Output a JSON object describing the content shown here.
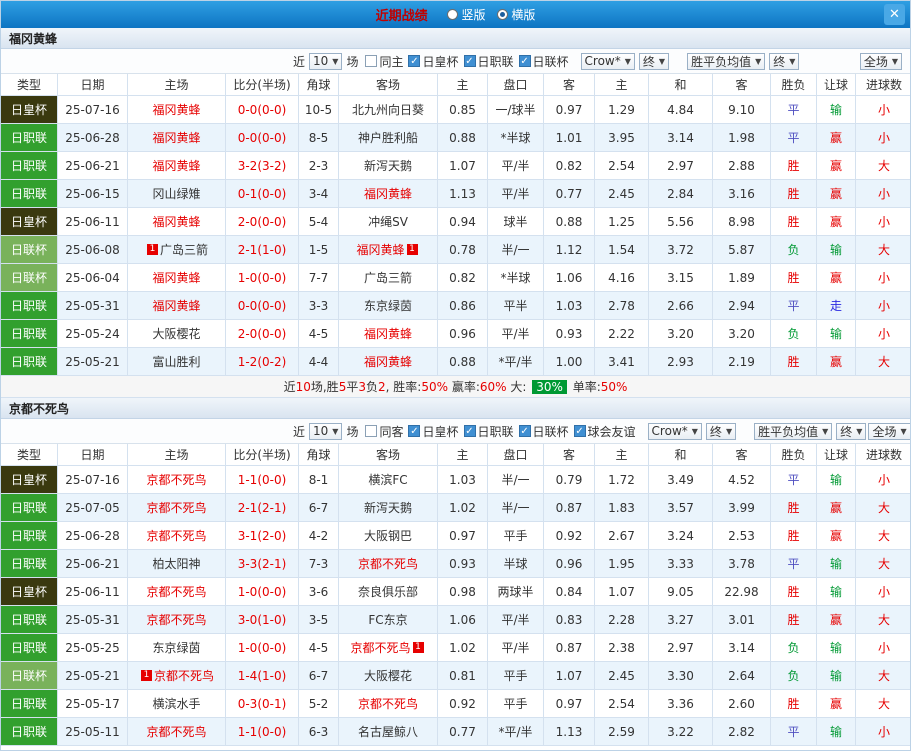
{
  "colors": {
    "league": {
      "日皇杯": "#3a390f",
      "日职联": "#32a02e",
      "日联杯": "#79b25b"
    },
    "status": {
      "win": "#e60000",
      "draw": "#4f4fc0",
      "lose": "#009933",
      "red": "#e60000",
      "blue": "#2a2ae0"
    },
    "focus_team": "#e60000",
    "score": "#e60000",
    "summary_highlight_bg": "#009933"
  },
  "topbar": {
    "title": "近期战绩",
    "radio_vertical": "竖版",
    "radio_horizontal": "横版",
    "selected": "横版",
    "close_glyph": "✕"
  },
  "table_columns": [
    "类型",
    "日期",
    "主场",
    "比分(半场)",
    "角球",
    "客场",
    "主",
    "盘口",
    "客",
    "主",
    "和",
    "客",
    "胜负",
    "让球",
    "进球数"
  ],
  "sections": [
    {
      "team": "福冈黄蜂",
      "filter": {
        "near": "近",
        "count": "10",
        "unit": "场",
        "checkboxes": [
          {
            "label": "同主",
            "checked": false
          },
          {
            "label": "日皇杯",
            "checked": true
          },
          {
            "label": "日职联",
            "checked": true
          },
          {
            "label": "日联杯",
            "checked": true
          }
        ],
        "selects": [
          "Crow*",
          "终",
          "胜平负均值",
          "终",
          "全场"
        ]
      },
      "rows": [
        {
          "league": "日皇杯",
          "date": "25-07-16",
          "home": {
            "name": "福冈黄蜂",
            "focus": true
          },
          "score": "0-0(0-0)",
          "corners": "10-5",
          "away": {
            "name": "北九州向日葵"
          },
          "ah": [
            "0.85",
            "一/球半",
            "0.97"
          ],
          "eu": [
            "1.29",
            "4.84",
            "9.10"
          ],
          "res": [
            "平",
            "draw"
          ],
          "let": [
            "输",
            "lose"
          ],
          "goal": [
            "小",
            "red"
          ]
        },
        {
          "league": "日职联",
          "date": "25-06-28",
          "home": {
            "name": "福冈黄蜂",
            "focus": true
          },
          "score": "0-0(0-0)",
          "corners": "8-5",
          "away": {
            "name": "神户胜利船"
          },
          "ah": [
            "0.88",
            "*半球",
            "1.01"
          ],
          "eu": [
            "3.95",
            "3.14",
            "1.98"
          ],
          "res": [
            "平",
            "draw"
          ],
          "let": [
            "赢",
            "win"
          ],
          "goal": [
            "小",
            "red"
          ]
        },
        {
          "league": "日职联",
          "date": "25-06-21",
          "home": {
            "name": "福冈黄蜂",
            "focus": true
          },
          "score": "3-2(3-2)",
          "corners": "2-3",
          "away": {
            "name": "新泻天鹅"
          },
          "ah": [
            "1.07",
            "平/半",
            "0.82"
          ],
          "eu": [
            "2.54",
            "2.97",
            "2.88"
          ],
          "res": [
            "胜",
            "win"
          ],
          "let": [
            "赢",
            "win"
          ],
          "goal": [
            "大",
            "red"
          ]
        },
        {
          "league": "日职联",
          "date": "25-06-15",
          "home": {
            "name": "冈山绿雉"
          },
          "score": "0-1(0-0)",
          "corners": "3-4",
          "away": {
            "name": "福冈黄蜂",
            "focus": true
          },
          "ah": [
            "1.13",
            "平/半",
            "0.77"
          ],
          "eu": [
            "2.45",
            "2.84",
            "3.16"
          ],
          "res": [
            "胜",
            "win"
          ],
          "let": [
            "赢",
            "win"
          ],
          "goal": [
            "小",
            "red"
          ]
        },
        {
          "league": "日皇杯",
          "date": "25-06-11",
          "home": {
            "name": "福冈黄蜂",
            "focus": true
          },
          "score": "2-0(0-0)",
          "corners": "5-4",
          "away": {
            "name": "冲绳SV"
          },
          "ah": [
            "0.94",
            "球半",
            "0.88"
          ],
          "eu": [
            "1.25",
            "5.56",
            "8.98"
          ],
          "res": [
            "胜",
            "win"
          ],
          "let": [
            "赢",
            "win"
          ],
          "goal": [
            "小",
            "red"
          ]
        },
        {
          "league": "日联杯",
          "date": "25-06-08",
          "home": {
            "name": "广岛三箭",
            "badge": "1"
          },
          "score": "2-1(1-0)",
          "corners": "1-5",
          "away": {
            "name": "福冈黄蜂",
            "focus": true,
            "badge": "1"
          },
          "ah": [
            "0.78",
            "半/一",
            "1.12"
          ],
          "eu": [
            "1.54",
            "3.72",
            "5.87"
          ],
          "res": [
            "负",
            "lose"
          ],
          "let": [
            "输",
            "lose"
          ],
          "goal": [
            "大",
            "red"
          ]
        },
        {
          "league": "日联杯",
          "date": "25-06-04",
          "home": {
            "name": "福冈黄蜂",
            "focus": true
          },
          "score": "1-0(0-0)",
          "corners": "7-7",
          "away": {
            "name": "广岛三箭"
          },
          "ah": [
            "0.82",
            "*半球",
            "1.06"
          ],
          "eu": [
            "4.16",
            "3.15",
            "1.89"
          ],
          "res": [
            "胜",
            "win"
          ],
          "let": [
            "赢",
            "win"
          ],
          "goal": [
            "小",
            "red"
          ]
        },
        {
          "league": "日职联",
          "date": "25-05-31",
          "home": {
            "name": "福冈黄蜂",
            "focus": true
          },
          "score": "0-0(0-0)",
          "corners": "3-3",
          "away": {
            "name": "东京绿茵"
          },
          "ah": [
            "0.86",
            "平半",
            "1.03"
          ],
          "eu": [
            "2.78",
            "2.66",
            "2.94"
          ],
          "res": [
            "平",
            "draw"
          ],
          "let": [
            "走",
            "blue"
          ],
          "goal": [
            "小",
            "red"
          ]
        },
        {
          "league": "日职联",
          "date": "25-05-24",
          "home": {
            "name": "大阪樱花"
          },
          "score": "2-0(0-0)",
          "corners": "4-5",
          "away": {
            "name": "福冈黄蜂",
            "focus": true
          },
          "ah": [
            "0.96",
            "平/半",
            "0.93"
          ],
          "eu": [
            "2.22",
            "3.20",
            "3.20"
          ],
          "res": [
            "负",
            "lose"
          ],
          "let": [
            "输",
            "lose"
          ],
          "goal": [
            "小",
            "red"
          ]
        },
        {
          "league": "日职联",
          "date": "25-05-21",
          "home": {
            "name": "富山胜利"
          },
          "score": "1-2(0-2)",
          "corners": "4-4",
          "away": {
            "name": "福冈黄蜂",
            "focus": true
          },
          "ah": [
            "0.88",
            "*平/半",
            "1.00"
          ],
          "eu": [
            "3.41",
            "2.93",
            "2.19"
          ],
          "res": [
            "胜",
            "win"
          ],
          "let": [
            "赢",
            "win"
          ],
          "goal": [
            "大",
            "red"
          ]
        }
      ],
      "summary": [
        {
          "t": "近"
        },
        {
          "t": "10",
          "c": "red"
        },
        {
          "t": "场,胜"
        },
        {
          "t": "5",
          "c": "red"
        },
        {
          "t": "平"
        },
        {
          "t": "3",
          "c": "red"
        },
        {
          "t": "负"
        },
        {
          "t": "2",
          "c": "red"
        },
        {
          "t": ", 胜率:"
        },
        {
          "t": "50%",
          "c": "red"
        },
        {
          "t": " 赢率:"
        },
        {
          "t": "60%",
          "c": "red"
        },
        {
          "t": " 大: "
        },
        {
          "t": "30%",
          "c": "badge"
        },
        {
          "t": " 单率:"
        },
        {
          "t": "50%",
          "c": "red"
        }
      ]
    },
    {
      "team": "京都不死鸟",
      "filter": {
        "near": "近",
        "count": "10",
        "unit": "场",
        "checkboxes": [
          {
            "label": "同客",
            "checked": false
          },
          {
            "label": "日皇杯",
            "checked": true
          },
          {
            "label": "日职联",
            "checked": true
          },
          {
            "label": "日联杯",
            "checked": true
          },
          {
            "label": "球会友谊",
            "checked": true
          }
        ],
        "selects": [
          "Crow*",
          "终",
          "胜平负均值",
          "终",
          "全场"
        ]
      },
      "rows": [
        {
          "league": "日皇杯",
          "date": "25-07-16",
          "home": {
            "name": "京都不死鸟",
            "focus": true
          },
          "score": "1-1(0-0)",
          "corners": "8-1",
          "away": {
            "name": "横滨FC"
          },
          "ah": [
            "1.03",
            "半/一",
            "0.79"
          ],
          "eu": [
            "1.72",
            "3.49",
            "4.52"
          ],
          "res": [
            "平",
            "draw"
          ],
          "let": [
            "输",
            "lose"
          ],
          "goal": [
            "小",
            "red"
          ]
        },
        {
          "league": "日职联",
          "date": "25-07-05",
          "home": {
            "name": "京都不死鸟",
            "focus": true
          },
          "score": "2-1(2-1)",
          "corners": "6-7",
          "away": {
            "name": "新泻天鹅"
          },
          "ah": [
            "1.02",
            "半/一",
            "0.87"
          ],
          "eu": [
            "1.83",
            "3.57",
            "3.99"
          ],
          "res": [
            "胜",
            "win"
          ],
          "let": [
            "赢",
            "win"
          ],
          "goal": [
            "大",
            "red"
          ]
        },
        {
          "league": "日职联",
          "date": "25-06-28",
          "home": {
            "name": "京都不死鸟",
            "focus": true
          },
          "score": "3-1(2-0)",
          "corners": "4-2",
          "away": {
            "name": "大阪钢巴"
          },
          "ah": [
            "0.97",
            "平手",
            "0.92"
          ],
          "eu": [
            "2.67",
            "3.24",
            "2.53"
          ],
          "res": [
            "胜",
            "win"
          ],
          "let": [
            "赢",
            "win"
          ],
          "goal": [
            "大",
            "red"
          ]
        },
        {
          "league": "日职联",
          "date": "25-06-21",
          "home": {
            "name": "柏太阳神"
          },
          "score": "3-3(2-1)",
          "corners": "7-3",
          "away": {
            "name": "京都不死鸟",
            "focus": true
          },
          "ah": [
            "0.93",
            "半球",
            "0.96"
          ],
          "eu": [
            "1.95",
            "3.33",
            "3.78"
          ],
          "res": [
            "平",
            "draw"
          ],
          "let": [
            "输",
            "lose"
          ],
          "goal": [
            "大",
            "red"
          ]
        },
        {
          "league": "日皇杯",
          "date": "25-06-11",
          "home": {
            "name": "京都不死鸟",
            "focus": true
          },
          "score": "1-0(0-0)",
          "corners": "3-6",
          "away": {
            "name": "奈良俱乐部"
          },
          "ah": [
            "0.98",
            "两球半",
            "0.84"
          ],
          "eu": [
            "1.07",
            "9.05",
            "22.98"
          ],
          "res": [
            "胜",
            "win"
          ],
          "let": [
            "输",
            "lose"
          ],
          "goal": [
            "小",
            "red"
          ]
        },
        {
          "league": "日职联",
          "date": "25-05-31",
          "home": {
            "name": "京都不死鸟",
            "focus": true
          },
          "score": "3-0(1-0)",
          "corners": "3-5",
          "away": {
            "name": "FC东京"
          },
          "ah": [
            "1.06",
            "平/半",
            "0.83"
          ],
          "eu": [
            "2.28",
            "3.27",
            "3.01"
          ],
          "res": [
            "胜",
            "win"
          ],
          "let": [
            "赢",
            "win"
          ],
          "goal": [
            "大",
            "red"
          ]
        },
        {
          "league": "日职联",
          "date": "25-05-25",
          "home": {
            "name": "东京绿茵"
          },
          "score": "1-0(0-0)",
          "corners": "4-5",
          "away": {
            "name": "京都不死鸟",
            "focus": true,
            "badge": "1"
          },
          "ah": [
            "1.02",
            "平/半",
            "0.87"
          ],
          "eu": [
            "2.38",
            "2.97",
            "3.14"
          ],
          "res": [
            "负",
            "lose"
          ],
          "let": [
            "输",
            "lose"
          ],
          "goal": [
            "小",
            "red"
          ]
        },
        {
          "league": "日联杯",
          "date": "25-05-21",
          "home": {
            "name": "京都不死鸟",
            "focus": true,
            "badge": "1"
          },
          "score": "1-4(1-0)",
          "corners": "6-7",
          "away": {
            "name": "大阪樱花"
          },
          "ah": [
            "0.81",
            "平手",
            "1.07"
          ],
          "eu": [
            "2.45",
            "3.30",
            "2.64"
          ],
          "res": [
            "负",
            "lose"
          ],
          "let": [
            "输",
            "lose"
          ],
          "goal": [
            "大",
            "red"
          ]
        },
        {
          "league": "日职联",
          "date": "25-05-17",
          "home": {
            "name": "横滨水手"
          },
          "score": "0-3(0-1)",
          "corners": "5-2",
          "away": {
            "name": "京都不死鸟",
            "focus": true
          },
          "ah": [
            "0.92",
            "平手",
            "0.97"
          ],
          "eu": [
            "2.54",
            "3.36",
            "2.60"
          ],
          "res": [
            "胜",
            "win"
          ],
          "let": [
            "赢",
            "win"
          ],
          "goal": [
            "大",
            "red"
          ]
        },
        {
          "league": "日职联",
          "date": "25-05-11",
          "home": {
            "name": "京都不死鸟",
            "focus": true
          },
          "score": "1-1(0-0)",
          "corners": "6-3",
          "away": {
            "name": "名古屋鲸八"
          },
          "ah": [
            "0.77",
            "*平/半",
            "1.13"
          ],
          "eu": [
            "2.59",
            "3.22",
            "2.82"
          ],
          "res": [
            "平",
            "draw"
          ],
          "let": [
            "输",
            "lose"
          ],
          "goal": [
            "小",
            "red"
          ]
        }
      ],
      "summary": null
    }
  ]
}
